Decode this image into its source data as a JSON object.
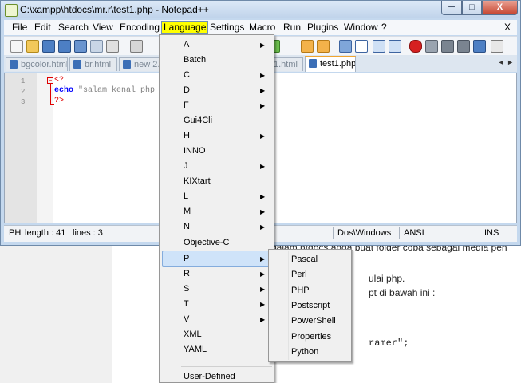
{
  "window": {
    "title": "C:\\xampp\\htdocs\\mr.r\\test1.php - Notepad++",
    "min_label": "─",
    "max_label": "□",
    "close_label": "X"
  },
  "menubar": {
    "items": [
      "File",
      "Edit",
      "Search",
      "View",
      "Encoding",
      "Language",
      "Settings",
      "Macro",
      "Run",
      "Plugins",
      "Window",
      "?"
    ],
    "active": "Language",
    "close_doc": "X"
  },
  "tabs": [
    {
      "label": "bgcolor.html"
    },
    {
      "label": "br.html"
    },
    {
      "label": "new 2.h"
    },
    {
      "label": "1.html"
    },
    {
      "label": "test1.php"
    }
  ],
  "tab_arrows": "◄ ►",
  "editor": {
    "line_numbers": [
      "1",
      "2",
      "3"
    ],
    "lines": [
      {
        "parts": [
          {
            "text": "<?",
            "cls": "k-red"
          }
        ]
      },
      {
        "parts": [
          {
            "text": "echo ",
            "cls": "k-blue"
          },
          {
            "text": "\"salam kenal php",
            "cls": "k-str"
          }
        ]
      },
      {
        "parts": [
          {
            "text": "?>",
            "cls": "k-red"
          }
        ]
      }
    ]
  },
  "status": {
    "type": "PH",
    "length": "length : 41",
    "lines": "lines : 3",
    "eol": "Dos\\Windows",
    "encoding": "ANSI",
    "mode": "INS"
  },
  "language_menu": {
    "items": [
      {
        "label": "A",
        "sub": true
      },
      {
        "label": "Batch",
        "sub": false
      },
      {
        "label": "C",
        "sub": true
      },
      {
        "label": "D",
        "sub": true
      },
      {
        "label": "F",
        "sub": true
      },
      {
        "label": "Gui4Cli",
        "sub": false
      },
      {
        "label": "H",
        "sub": true
      },
      {
        "label": "INNO",
        "sub": false
      },
      {
        "label": "J",
        "sub": true
      },
      {
        "label": "KIXtart",
        "sub": false
      },
      {
        "label": "L",
        "sub": true
      },
      {
        "label": "M",
        "sub": true
      },
      {
        "label": "N",
        "sub": true
      },
      {
        "label": "Objective-C",
        "sub": false
      },
      {
        "label": "P",
        "sub": true
      },
      {
        "label": "R",
        "sub": true
      },
      {
        "label": "S",
        "sub": true
      },
      {
        "label": "T",
        "sub": true
      },
      {
        "label": "V",
        "sub": true
      },
      {
        "label": "XML",
        "sub": false
      },
      {
        "label": "YAML",
        "sub": false
      },
      {
        "label": "User-Defined",
        "sub": false
      }
    ],
    "highlighted": "P"
  },
  "p_submenu": {
    "items": [
      "Pascal",
      "Perl",
      "PHP",
      "Postscript",
      "PowerShell",
      "Properties",
      "Python"
    ],
    "highlighted": "PHP"
  },
  "background_doc": {
    "line1": "dalam htdocs anda buat folder coba sebagai media pen",
    "line2": "ulai php.",
    "line3": "pt di bawah ini :",
    "line4": "ramer\";"
  },
  "colors": {
    "highlight_yellow": "#ffff00",
    "menu_hover": "#cfe3f9"
  }
}
